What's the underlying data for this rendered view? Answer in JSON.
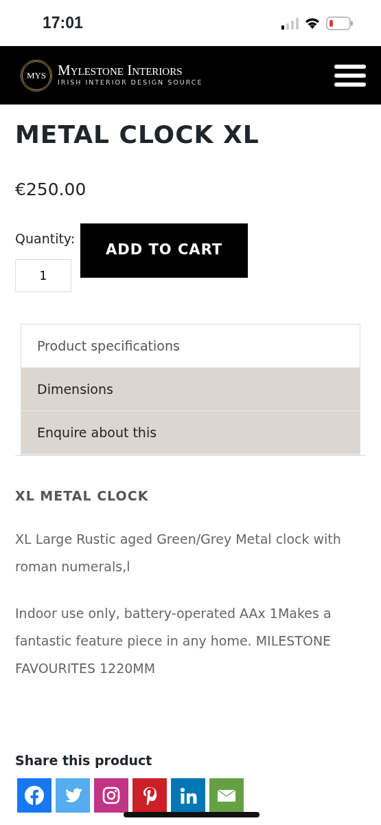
{
  "status_bar": {
    "time": "17:01"
  },
  "header": {
    "logo_mark": "MYS",
    "brand": "Mylestone Interiors",
    "tagline": "IRISH INTERIOR DESIGN SOURCE"
  },
  "product": {
    "title": "METAL CLOCK XL",
    "price": "€250.00",
    "quantity_label": "Quantity:",
    "quantity": "1",
    "add_button": "ADD TO CART"
  },
  "accordion": [
    {
      "label": "Product specifications",
      "expanded": true
    },
    {
      "label": "Dimensions",
      "expanded": false
    },
    {
      "label": "Enquire about this",
      "expanded": false
    }
  ],
  "description": {
    "heading": "XL  METAL CLOCK",
    "paragraphs": [
      "XL Large Rustic aged Green/Grey Metal clock with roman numerals,l",
      "Indoor use only, battery-operated  AAx 1Makes a fantastic feature piece in any home. MILESTONE FAVOURITES  1220MM"
    ]
  },
  "share": {
    "heading": "Share this product",
    "buttons": [
      {
        "kind": "facebook",
        "color": "#1877f2"
      },
      {
        "kind": "twitter",
        "color": "#55acee"
      },
      {
        "kind": "instagram",
        "color": "#c13584"
      },
      {
        "kind": "pinterest",
        "color": "#cb2027"
      },
      {
        "kind": "linkedin",
        "color": "#0077b5"
      },
      {
        "kind": "email",
        "color": "#65a143"
      }
    ]
  }
}
